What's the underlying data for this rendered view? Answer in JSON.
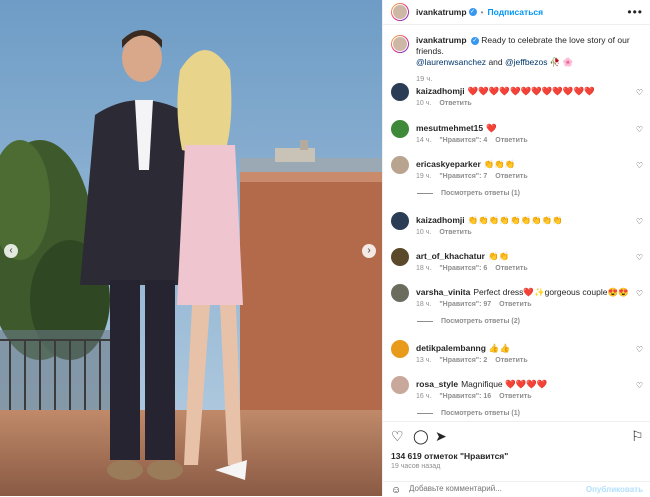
{
  "post_header": {
    "username": "ivankatrump",
    "separator": "•",
    "follow_label": "Подписаться",
    "more_label": "•••"
  },
  "caption": {
    "username": "ivankatrump",
    "text": "Ready to celebrate the love story of our friends.",
    "mention1": "@laurenwsanchez",
    "and_text": "and",
    "mention2": "@jeffbezos",
    "emojis": "🥀 🌸",
    "time": "19 ч."
  },
  "comments": [
    {
      "username": "kaizadhomji",
      "text": "❤️❤️❤️❤️❤️❤️❤️❤️❤️❤️❤️❤️",
      "time": "10 ч.",
      "likes": "",
      "reply": "Ответить",
      "avatar_color": "#2b3c55"
    },
    {
      "username": "mesutmehmet15",
      "text": "❤️",
      "time": "14 ч.",
      "likes": "\"Нравится\": 4",
      "reply": "Ответить",
      "avatar_color": "#3f8a3a"
    },
    {
      "username": "ericaskyeparker",
      "text": "👏👏👏",
      "time": "19 ч.",
      "likes": "\"Нравится\": 7",
      "reply": "Ответить",
      "avatar_color": "#b9a490",
      "view_replies": "Посмотреть ответы (1)"
    },
    {
      "username": "kaizadhomji",
      "text": "👏👏👏👏👏👏👏👏👏",
      "time": "10 ч.",
      "likes": "",
      "reply": "Ответить",
      "avatar_color": "#2b3c55"
    },
    {
      "username": "art_of_khachatur",
      "text": "👏👏",
      "time": "18 ч.",
      "likes": "\"Нравится\": 6",
      "reply": "Ответить",
      "avatar_color": "#5a4a2a"
    },
    {
      "username": "varsha_vinita",
      "text": "Perfect dress❤️✨gorgeous couple😍😍",
      "time": "18 ч.",
      "likes": "\"Нравится\": 97",
      "reply": "Ответить",
      "avatar_color": "#6b6b5e",
      "view_replies": "Посмотреть ответы (2)"
    },
    {
      "username": "detikpalembanng",
      "text": "👍👍",
      "time": "13 ч.",
      "likes": "\"Нравится\": 2",
      "reply": "Ответить",
      "avatar_color": "#e89a1a"
    },
    {
      "username": "rosa_style",
      "text": "Magnifique ❤️❤️❤️❤️",
      "time": "16 ч.",
      "likes": "\"Нравится\": 16",
      "reply": "Ответить",
      "avatar_color": "#c7a89a",
      "view_replies": "Посмотреть ответы (1)"
    }
  ],
  "actions": {
    "likes_count": "134 619 отметок \"Нравится\"",
    "time_ago": "19 часов назад"
  },
  "composer": {
    "placeholder": "Добавьте комментарий...",
    "publish_label": "Опубликовать"
  },
  "media": {
    "prev": "‹",
    "next": "›"
  }
}
